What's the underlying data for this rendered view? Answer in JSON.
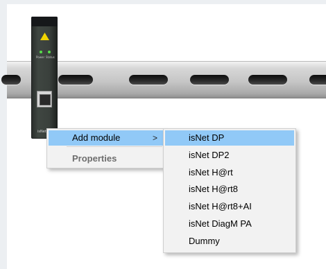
{
  "device": {
    "led_labels": [
      "Power",
      "Status"
    ],
    "name": "isNet Lite"
  },
  "context_menu": {
    "items": [
      {
        "label": "Add module",
        "arrow": ">"
      },
      {
        "label": "Properties"
      }
    ]
  },
  "submenu": {
    "items": [
      {
        "label": "isNet DP"
      },
      {
        "label": "isNet DP2"
      },
      {
        "label": "isNet H@rt"
      },
      {
        "label": "isNet H@rt8"
      },
      {
        "label": "isNet H@rt8+AI"
      },
      {
        "label": "isNet DiagM PA"
      },
      {
        "label": "Dummy"
      }
    ]
  },
  "colors": {
    "highlight": "#91c9f7",
    "menu_bg": "#f2f2f2",
    "led": "#57e04a",
    "logo": "#f2d400"
  }
}
